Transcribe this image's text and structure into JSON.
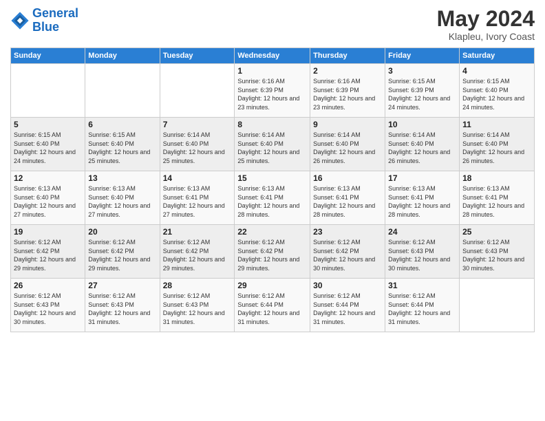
{
  "header": {
    "logo_line1": "General",
    "logo_line2": "Blue",
    "main_title": "May 2024",
    "subtitle": "Klapleu, Ivory Coast"
  },
  "days_of_week": [
    "Sunday",
    "Monday",
    "Tuesday",
    "Wednesday",
    "Thursday",
    "Friday",
    "Saturday"
  ],
  "weeks": [
    [
      {
        "day": "",
        "sunrise": "",
        "sunset": "",
        "daylight": ""
      },
      {
        "day": "",
        "sunrise": "",
        "sunset": "",
        "daylight": ""
      },
      {
        "day": "",
        "sunrise": "",
        "sunset": "",
        "daylight": ""
      },
      {
        "day": "1",
        "sunrise": "Sunrise: 6:16 AM",
        "sunset": "Sunset: 6:39 PM",
        "daylight": "Daylight: 12 hours and 23 minutes."
      },
      {
        "day": "2",
        "sunrise": "Sunrise: 6:16 AM",
        "sunset": "Sunset: 6:39 PM",
        "daylight": "Daylight: 12 hours and 23 minutes."
      },
      {
        "day": "3",
        "sunrise": "Sunrise: 6:15 AM",
        "sunset": "Sunset: 6:39 PM",
        "daylight": "Daylight: 12 hours and 24 minutes."
      },
      {
        "day": "4",
        "sunrise": "Sunrise: 6:15 AM",
        "sunset": "Sunset: 6:40 PM",
        "daylight": "Daylight: 12 hours and 24 minutes."
      }
    ],
    [
      {
        "day": "5",
        "sunrise": "Sunrise: 6:15 AM",
        "sunset": "Sunset: 6:40 PM",
        "daylight": "Daylight: 12 hours and 24 minutes."
      },
      {
        "day": "6",
        "sunrise": "Sunrise: 6:15 AM",
        "sunset": "Sunset: 6:40 PM",
        "daylight": "Daylight: 12 hours and 25 minutes."
      },
      {
        "day": "7",
        "sunrise": "Sunrise: 6:14 AM",
        "sunset": "Sunset: 6:40 PM",
        "daylight": "Daylight: 12 hours and 25 minutes."
      },
      {
        "day": "8",
        "sunrise": "Sunrise: 6:14 AM",
        "sunset": "Sunset: 6:40 PM",
        "daylight": "Daylight: 12 hours and 25 minutes."
      },
      {
        "day": "9",
        "sunrise": "Sunrise: 6:14 AM",
        "sunset": "Sunset: 6:40 PM",
        "daylight": "Daylight: 12 hours and 26 minutes."
      },
      {
        "day": "10",
        "sunrise": "Sunrise: 6:14 AM",
        "sunset": "Sunset: 6:40 PM",
        "daylight": "Daylight: 12 hours and 26 minutes."
      },
      {
        "day": "11",
        "sunrise": "Sunrise: 6:14 AM",
        "sunset": "Sunset: 6:40 PM",
        "daylight": "Daylight: 12 hours and 26 minutes."
      }
    ],
    [
      {
        "day": "12",
        "sunrise": "Sunrise: 6:13 AM",
        "sunset": "Sunset: 6:40 PM",
        "daylight": "Daylight: 12 hours and 27 minutes."
      },
      {
        "day": "13",
        "sunrise": "Sunrise: 6:13 AM",
        "sunset": "Sunset: 6:40 PM",
        "daylight": "Daylight: 12 hours and 27 minutes."
      },
      {
        "day": "14",
        "sunrise": "Sunrise: 6:13 AM",
        "sunset": "Sunset: 6:41 PM",
        "daylight": "Daylight: 12 hours and 27 minutes."
      },
      {
        "day": "15",
        "sunrise": "Sunrise: 6:13 AM",
        "sunset": "Sunset: 6:41 PM",
        "daylight": "Daylight: 12 hours and 28 minutes."
      },
      {
        "day": "16",
        "sunrise": "Sunrise: 6:13 AM",
        "sunset": "Sunset: 6:41 PM",
        "daylight": "Daylight: 12 hours and 28 minutes."
      },
      {
        "day": "17",
        "sunrise": "Sunrise: 6:13 AM",
        "sunset": "Sunset: 6:41 PM",
        "daylight": "Daylight: 12 hours and 28 minutes."
      },
      {
        "day": "18",
        "sunrise": "Sunrise: 6:13 AM",
        "sunset": "Sunset: 6:41 PM",
        "daylight": "Daylight: 12 hours and 28 minutes."
      }
    ],
    [
      {
        "day": "19",
        "sunrise": "Sunrise: 6:12 AM",
        "sunset": "Sunset: 6:42 PM",
        "daylight": "Daylight: 12 hours and 29 minutes."
      },
      {
        "day": "20",
        "sunrise": "Sunrise: 6:12 AM",
        "sunset": "Sunset: 6:42 PM",
        "daylight": "Daylight: 12 hours and 29 minutes."
      },
      {
        "day": "21",
        "sunrise": "Sunrise: 6:12 AM",
        "sunset": "Sunset: 6:42 PM",
        "daylight": "Daylight: 12 hours and 29 minutes."
      },
      {
        "day": "22",
        "sunrise": "Sunrise: 6:12 AM",
        "sunset": "Sunset: 6:42 PM",
        "daylight": "Daylight: 12 hours and 29 minutes."
      },
      {
        "day": "23",
        "sunrise": "Sunrise: 6:12 AM",
        "sunset": "Sunset: 6:42 PM",
        "daylight": "Daylight: 12 hours and 30 minutes."
      },
      {
        "day": "24",
        "sunrise": "Sunrise: 6:12 AM",
        "sunset": "Sunset: 6:43 PM",
        "daylight": "Daylight: 12 hours and 30 minutes."
      },
      {
        "day": "25",
        "sunrise": "Sunrise: 6:12 AM",
        "sunset": "Sunset: 6:43 PM",
        "daylight": "Daylight: 12 hours and 30 minutes."
      }
    ],
    [
      {
        "day": "26",
        "sunrise": "Sunrise: 6:12 AM",
        "sunset": "Sunset: 6:43 PM",
        "daylight": "Daylight: 12 hours and 30 minutes."
      },
      {
        "day": "27",
        "sunrise": "Sunrise: 6:12 AM",
        "sunset": "Sunset: 6:43 PM",
        "daylight": "Daylight: 12 hours and 31 minutes."
      },
      {
        "day": "28",
        "sunrise": "Sunrise: 6:12 AM",
        "sunset": "Sunset: 6:43 PM",
        "daylight": "Daylight: 12 hours and 31 minutes."
      },
      {
        "day": "29",
        "sunrise": "Sunrise: 6:12 AM",
        "sunset": "Sunset: 6:44 PM",
        "daylight": "Daylight: 12 hours and 31 minutes."
      },
      {
        "day": "30",
        "sunrise": "Sunrise: 6:12 AM",
        "sunset": "Sunset: 6:44 PM",
        "daylight": "Daylight: 12 hours and 31 minutes."
      },
      {
        "day": "31",
        "sunrise": "Sunrise: 6:12 AM",
        "sunset": "Sunset: 6:44 PM",
        "daylight": "Daylight: 12 hours and 31 minutes."
      },
      {
        "day": "",
        "sunrise": "",
        "sunset": "",
        "daylight": ""
      }
    ]
  ]
}
